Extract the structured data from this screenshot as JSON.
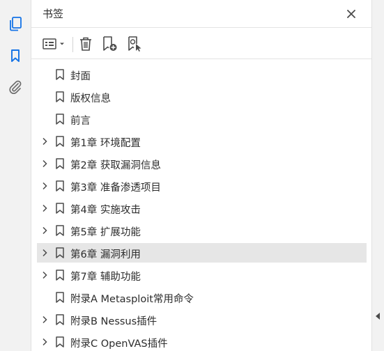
{
  "rail": {
    "icons": [
      "pages-icon",
      "bookmark-icon",
      "attachment-icon"
    ],
    "active_color": "#1473e6"
  },
  "panel": {
    "title": "书签"
  },
  "toolbar": {
    "icons": [
      "options-menu-icon",
      "delete-icon",
      "new-bookmark-icon",
      "new-bookmark-from-selection-icon"
    ]
  },
  "bookmarks": [
    {
      "label": "封面",
      "expandable": false,
      "selected": false
    },
    {
      "label": "版权信息",
      "expandable": false,
      "selected": false
    },
    {
      "label": "前言",
      "expandable": false,
      "selected": false
    },
    {
      "label": "第1章 环境配置",
      "expandable": true,
      "selected": false
    },
    {
      "label": "第2章 获取漏洞信息",
      "expandable": true,
      "selected": false
    },
    {
      "label": "第3章 准备渗透项目",
      "expandable": true,
      "selected": false
    },
    {
      "label": "第4章 实施攻击",
      "expandable": true,
      "selected": false
    },
    {
      "label": "第5章 扩展功能",
      "expandable": true,
      "selected": false
    },
    {
      "label": "第6章 漏洞利用",
      "expandable": true,
      "selected": true
    },
    {
      "label": "第7章 辅助功能",
      "expandable": true,
      "selected": false
    },
    {
      "label": "附录A Metasploit常用命令",
      "expandable": false,
      "selected": false
    },
    {
      "label": "附录B Nessus插件",
      "expandable": true,
      "selected": false
    },
    {
      "label": "附录C OpenVAS插件",
      "expandable": true,
      "selected": false
    }
  ],
  "colors": {
    "selected_row": "#e6e6e6",
    "icon_gray": "#4b4b4b"
  }
}
